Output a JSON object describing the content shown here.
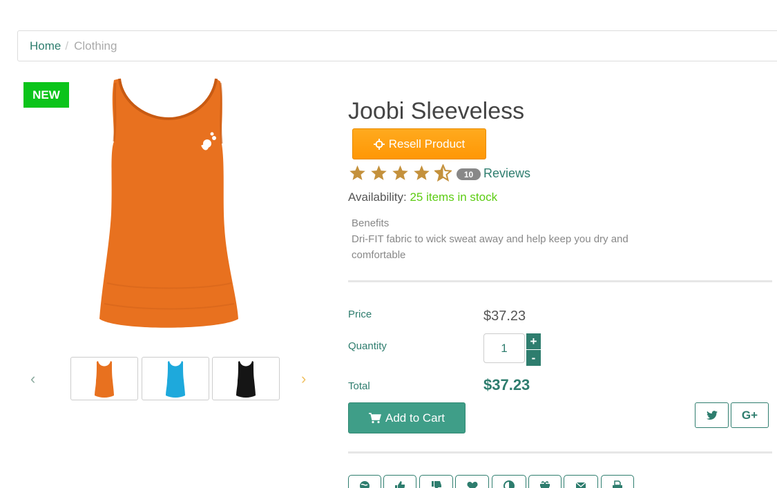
{
  "breadcrumb": {
    "home": "Home",
    "separator": "/",
    "current": "Clothing"
  },
  "badge": {
    "new": "NEW"
  },
  "product": {
    "title": "Joobi Sleeveless",
    "resell_label": "Resell Product",
    "rating": 4.5,
    "review_count": "10",
    "reviews_label": "Reviews",
    "availability_label": "Availability:",
    "availability_value": "25 items in stock",
    "benefits_title": "Benefits",
    "benefits_text": "Dri-FIT fabric to wick sweat away and help keep you dry and comfortable",
    "main_color": "#e8711f"
  },
  "gallery": {
    "prev": "‹",
    "next": "›",
    "thumbnails": [
      {
        "color": "#e8711f",
        "icon": "tank-top-orange"
      },
      {
        "color": "#1ea9dc",
        "icon": "tank-top-blue"
      },
      {
        "color": "#151515",
        "icon": "tank-top-black"
      }
    ]
  },
  "purchase": {
    "price_label": "Price",
    "price_value": "$37.23",
    "quantity_label": "Quantity",
    "quantity_value": "1",
    "plus": "+",
    "minus": "-",
    "total_label": "Total",
    "total_value": "$37.23",
    "add_to_cart": "Add to Cart"
  },
  "share": {
    "twitter_icon": "twitter-icon",
    "googleplus_label": "G+"
  },
  "actions": [
    "globe-icon",
    "thumbs-up-icon",
    "thumbs-down-icon",
    "heart-icon",
    "compare-icon",
    "gift-icon",
    "envelope-icon",
    "print-icon"
  ],
  "colors": {
    "accent": "#2e7d6e",
    "resell": "#ff9f10",
    "stock": "#5ccc12",
    "badge": "#0bc41a",
    "star": "#c4913c"
  }
}
